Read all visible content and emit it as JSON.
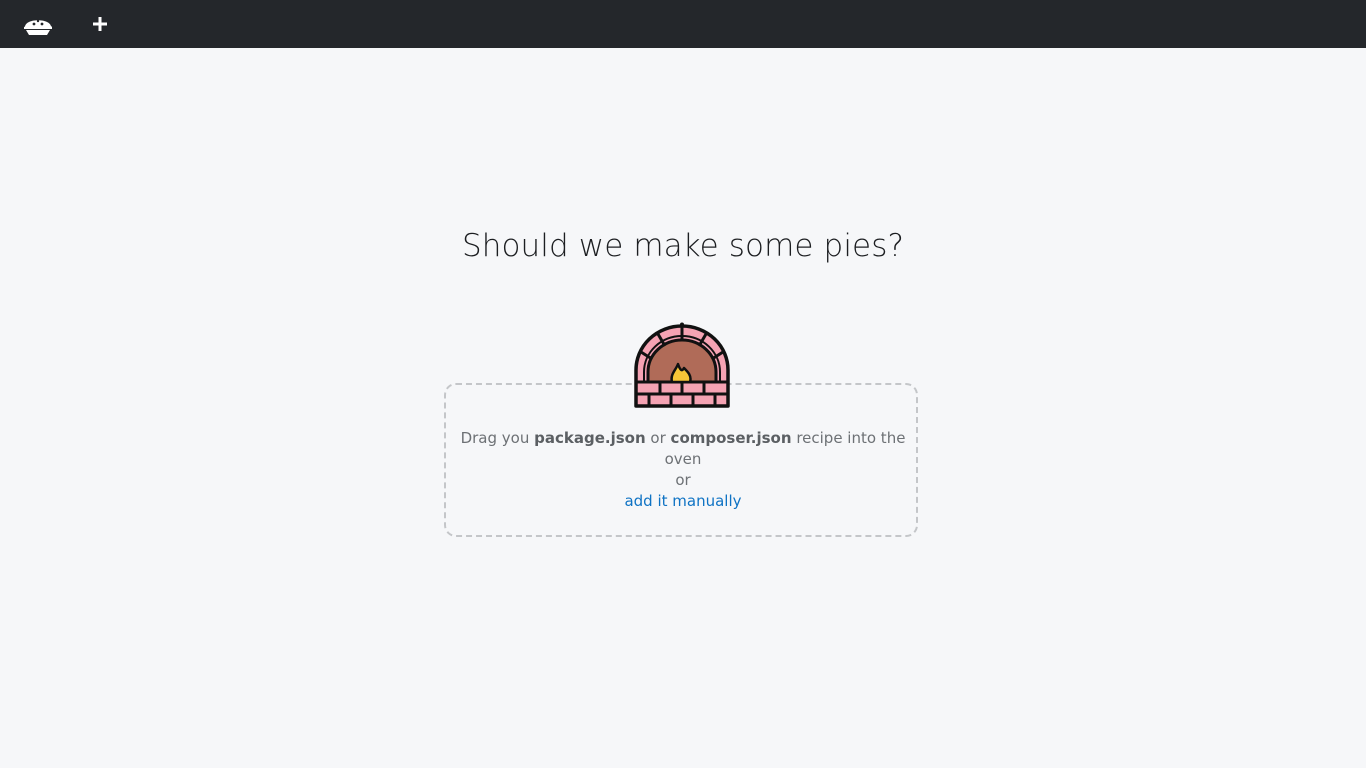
{
  "navbar": {
    "logo_icon": "pie-logo-icon",
    "add_icon": "plus-icon",
    "background": "#24272b"
  },
  "main": {
    "title": "Should we make some pies?",
    "oven_icon": "brick-oven-icon",
    "dropzone": {
      "prefix": "Drag you",
      "file1": "package.json",
      "middle": "or",
      "file2": "composer.json",
      "suffix": "recipe into the oven",
      "or": "or",
      "link_label": "add it manually"
    }
  },
  "colors": {
    "link": "#0f73c4",
    "text_muted": "#6d7175",
    "page_bg": "#f6f7f9",
    "brick": "#f5a3b3",
    "oven_inner": "#b06b58",
    "fire": "#f7c537"
  }
}
